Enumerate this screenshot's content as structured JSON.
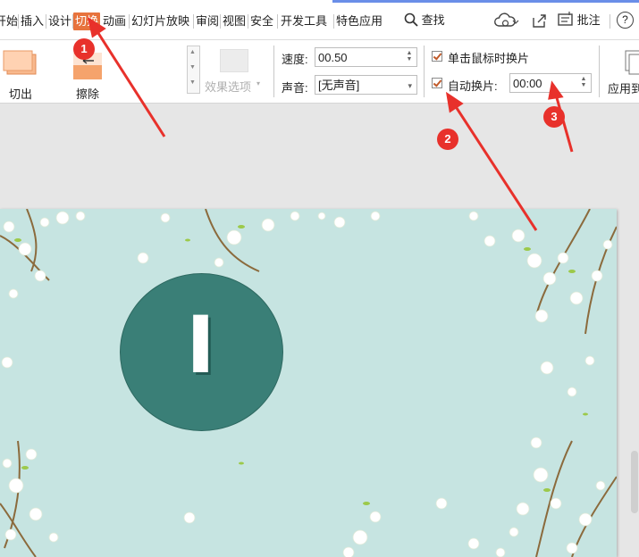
{
  "menu": {
    "tabs": [
      "开始",
      "插入",
      "设计",
      "切换",
      "动画",
      "幻灯片放映",
      "审阅",
      "视图",
      "安全",
      "开发工具",
      "特色应用"
    ],
    "active_tab": "切换",
    "search_label": "查找",
    "comment_label": "批注",
    "help_label": "?"
  },
  "ribbon": {
    "transitions": [
      {
        "label": "切出",
        "icon": "cut-out-transition-icon"
      },
      {
        "label": "擦除",
        "icon": "wipe-transition-icon"
      }
    ],
    "effect_options_label": "效果选项",
    "speed_label": "速度:",
    "speed_value": "00.50",
    "sound_label": "声音:",
    "sound_value": "[无声音]",
    "on_click_label": "单击鼠标时换片",
    "on_click_checked": true,
    "auto_advance_label": "自动换片:",
    "auto_advance_checked": true,
    "auto_advance_time": "00:00",
    "apply_all_label": "应用到"
  },
  "slide": {
    "title_letter": "I",
    "circle_color": "#3a7f77",
    "background_color": "#c6e4e1"
  },
  "annotations": [
    {
      "number": "1"
    },
    {
      "number": "2"
    },
    {
      "number": "3"
    }
  ],
  "colors": {
    "accent_active_tab": "#e7733d",
    "annotation_red": "#e8312b"
  }
}
